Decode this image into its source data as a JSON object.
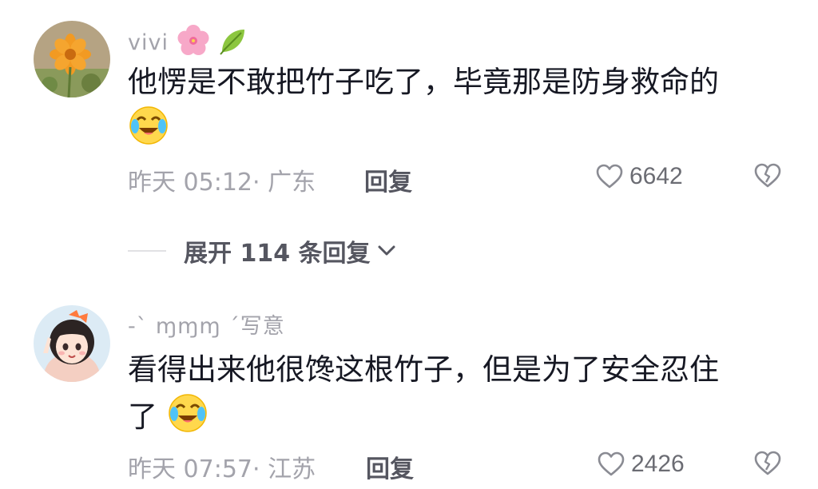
{
  "comments": [
    {
      "username": "vivi",
      "username_emojis": [
        "cherry-blossom-icon",
        "leaf-icon"
      ],
      "text_line1": "他愣是不敢把竹子吃了，毕竟那是防身救命的",
      "text_line2": "",
      "trailing_emoji": "crying-laughing-icon",
      "time": "昨天 05:12",
      "location": "· 广东",
      "reply_label": "回复",
      "likes": "6642"
    },
    {
      "username": "-` ɱɱɱ ´写意",
      "text_line1": "看得出来他很馋这根竹子，但是为了安全忍住",
      "text_line2": "了",
      "trailing_emoji": "crying-laughing-icon",
      "time": "昨天 07:57",
      "location": "· 江苏",
      "reply_label": "回复",
      "likes": "2426"
    }
  ],
  "expand_replies": {
    "label": "展开 114 条回复"
  },
  "colors": {
    "text_primary": "#161823",
    "text_secondary": "#a3a3ab",
    "reply": "#555660"
  }
}
